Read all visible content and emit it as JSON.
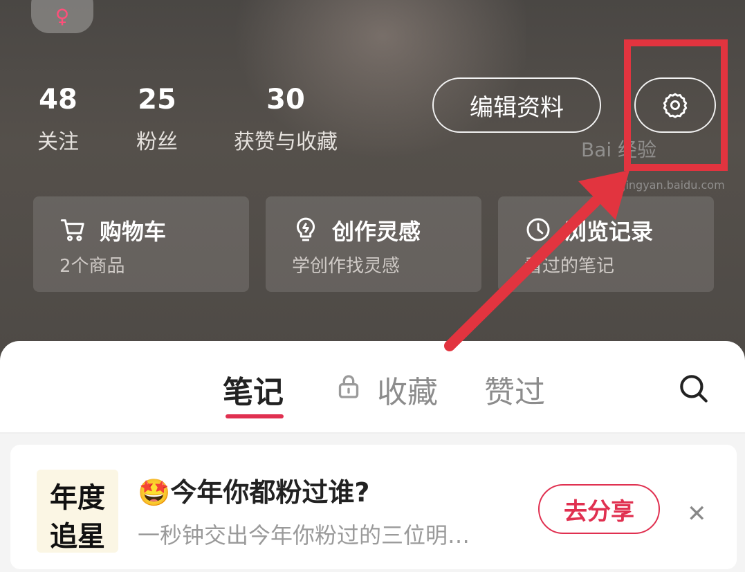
{
  "profile": {
    "gender_symbol": "♀",
    "stats": [
      {
        "value": "48",
        "label": "关注"
      },
      {
        "value": "25",
        "label": "粉丝"
      },
      {
        "value": "30",
        "label": "获赞与收藏"
      }
    ],
    "edit_button": "编辑资料",
    "settings_icon": "gear-icon"
  },
  "shortcuts": [
    {
      "title": "购物车",
      "subtitle": "2个商品",
      "icon": "cart-icon"
    },
    {
      "title": "创作灵感",
      "subtitle": "学创作找灵感",
      "icon": "lightbulb-icon"
    },
    {
      "title": "浏览记录",
      "subtitle": "看过的笔记",
      "icon": "clock-icon"
    }
  ],
  "tabs": {
    "items": [
      {
        "label": "笔记",
        "active": true
      },
      {
        "label": "收藏",
        "locked": true
      },
      {
        "label": "赞过"
      }
    ],
    "search_icon": "search-icon"
  },
  "banner": {
    "thumb_line1": "年度",
    "thumb_line2": "追星",
    "emoji": "🤩",
    "title": "今年你都粉过谁?",
    "subtitle": "一秒钟交出今年你粉过的三位明…",
    "action": "去分享",
    "close": "✕"
  },
  "watermark": {
    "text": "Bai 经验",
    "sub": "jingyan.baidu.com"
  },
  "colors": {
    "accent": "#e03050",
    "annotation": "#e2343f"
  }
}
